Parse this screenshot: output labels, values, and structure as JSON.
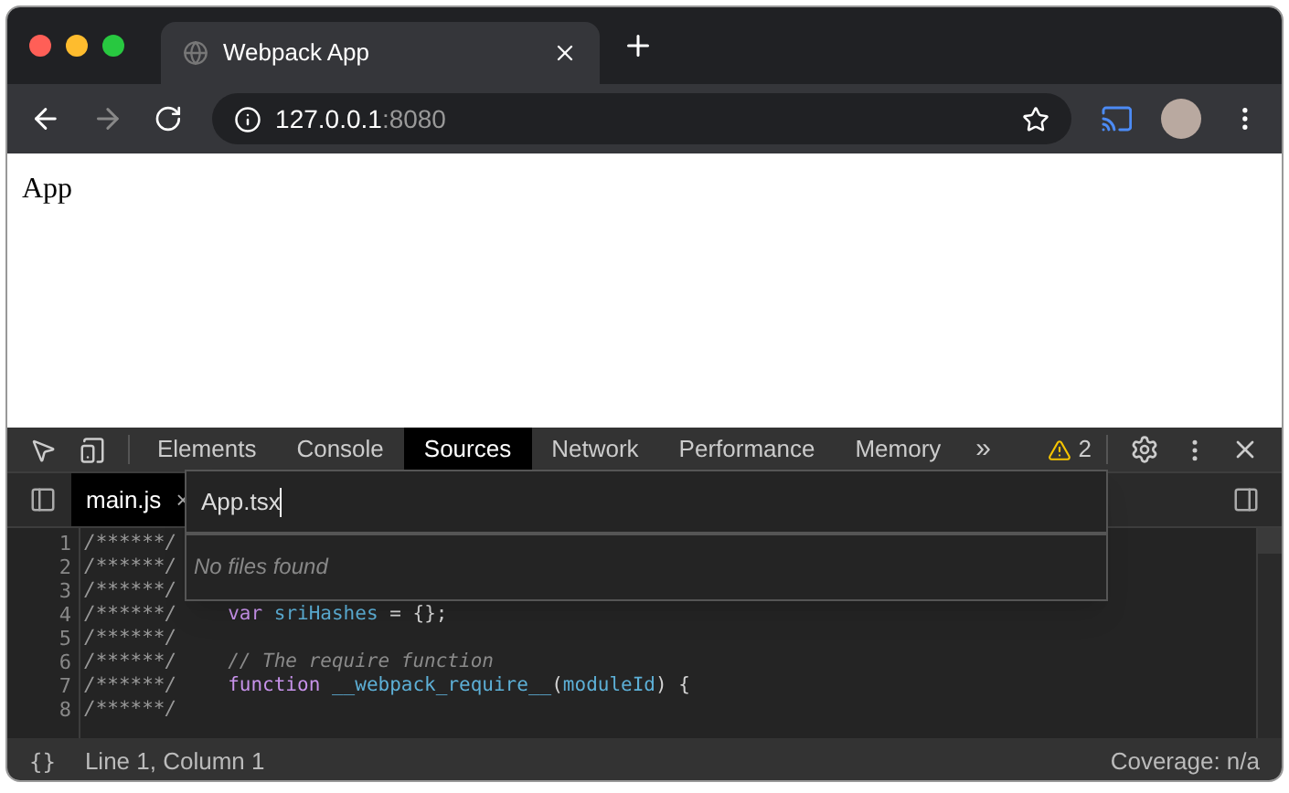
{
  "browser": {
    "tab": {
      "title": "Webpack App"
    },
    "address": {
      "host": "127.0.0.1",
      "port": ":8080"
    }
  },
  "page": {
    "text": "App"
  },
  "devtools": {
    "panels": [
      {
        "label": "Elements",
        "selected": false
      },
      {
        "label": "Console",
        "selected": false
      },
      {
        "label": "Sources",
        "selected": true
      },
      {
        "label": "Network",
        "selected": false
      },
      {
        "label": "Performance",
        "selected": false
      },
      {
        "label": "Memory",
        "selected": false
      }
    ],
    "more": "»",
    "warnings": "2",
    "file_tab": {
      "label": "main.js",
      "close": "×"
    },
    "quick_open": {
      "value": "App.tsx",
      "message": "No files found"
    },
    "code": [
      {
        "number": "1",
        "prefix": "/******/"
      },
      {
        "number": "2",
        "prefix": "/******/"
      },
      {
        "number": "3",
        "prefix": "/******/"
      },
      {
        "number": "4",
        "prefix": "/******/",
        "tokens": [
          {
            "kind": "keyword",
            "text": "var "
          },
          {
            "kind": "ident",
            "text": "sriHashes"
          },
          {
            "kind": "plain",
            "text": " = {};"
          }
        ]
      },
      {
        "number": "5",
        "prefix": "/******/"
      },
      {
        "number": "6",
        "prefix": "/******/",
        "tokens": [
          {
            "kind": "comment",
            "text": "// The require function"
          }
        ]
      },
      {
        "number": "7",
        "prefix": "/******/",
        "tokens": [
          {
            "kind": "keyword",
            "text": "function "
          },
          {
            "kind": "ident",
            "text": "__webpack_require__"
          },
          {
            "kind": "plain",
            "text": "("
          },
          {
            "kind": "ident",
            "text": "moduleId"
          },
          {
            "kind": "plain",
            "text": ") {"
          }
        ]
      },
      {
        "number": "8",
        "prefix": "/******/"
      }
    ],
    "status": {
      "format": "{}",
      "position": "Line 1, Column 1",
      "coverage": "Coverage: n/a"
    }
  }
}
